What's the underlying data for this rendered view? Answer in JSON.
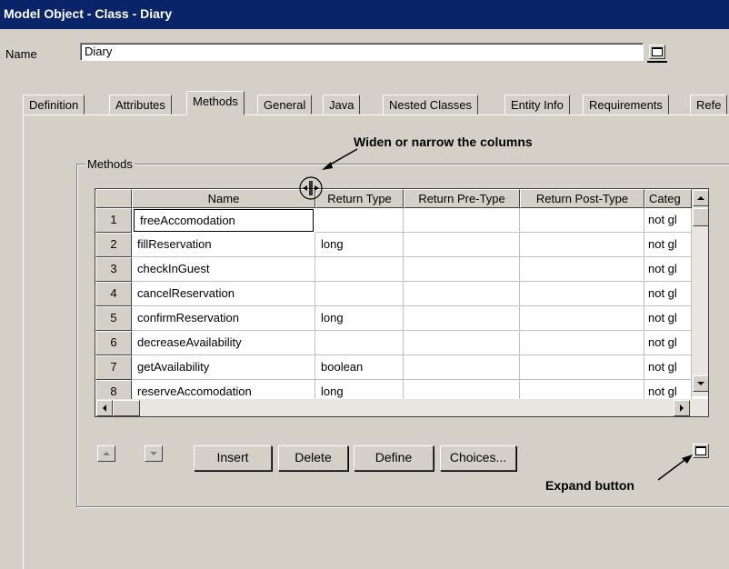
{
  "window": {
    "title": "Model Object - Class - Diary"
  },
  "name_field": {
    "label": "Name",
    "value": "Diary"
  },
  "tabs": [
    {
      "label": "Definition"
    },
    {
      "label": "Attributes"
    },
    {
      "label": "Methods"
    },
    {
      "label": "General"
    },
    {
      "label": "Java"
    },
    {
      "label": "Nested Classes"
    },
    {
      "label": "Entity Info"
    },
    {
      "label": "Requirements"
    },
    {
      "label": "Refe"
    }
  ],
  "active_tab": "Methods",
  "methods_group": {
    "label": "Methods"
  },
  "table": {
    "columns": [
      "Name",
      "Return Type",
      "Return Pre-Type",
      "Return Post-Type",
      "Categ"
    ],
    "rows": [
      {
        "num": "1",
        "name": "freeAccomodation",
        "return_type": "",
        "category": "not gl"
      },
      {
        "num": "2",
        "name": "fillReservation",
        "return_type": "long",
        "category": "not gl"
      },
      {
        "num": "3",
        "name": "checkInGuest",
        "return_type": "",
        "category": "not gl"
      },
      {
        "num": "4",
        "name": "cancelReservation",
        "return_type": "",
        "category": "not gl"
      },
      {
        "num": "5",
        "name": "confirmReservation",
        "return_type": "long",
        "category": "not gl"
      },
      {
        "num": "6",
        "name": "decreaseAvailability",
        "return_type": "",
        "category": "not gl"
      },
      {
        "num": "7",
        "name": "getAvailability",
        "return_type": "boolean",
        "category": "not gl"
      },
      {
        "num": "8",
        "name": "reserveAccomodation",
        "return_type": "long",
        "category": "not gl"
      }
    ]
  },
  "buttons": {
    "insert": "Insert",
    "delete": "Delete",
    "define": "Define",
    "choices": "Choices..."
  },
  "annotations": {
    "widen": "Widen or narrow the columns",
    "expand": "Expand button"
  },
  "icons": {
    "move_up": "arrow-up-icon",
    "move_down": "arrow-down-icon",
    "expand": "expand-icon",
    "resize": "column-resize-icon"
  }
}
